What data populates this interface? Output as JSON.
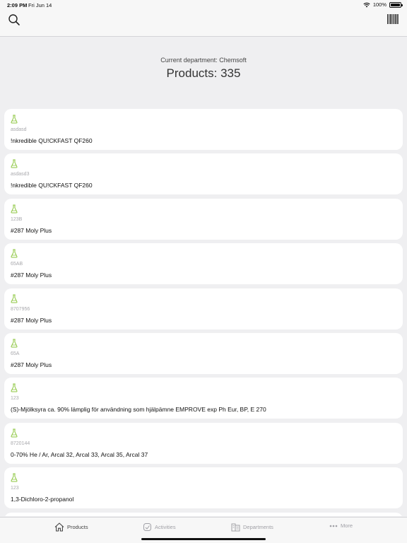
{
  "status_bar": {
    "time": "2:09 PM",
    "date": "Fri Jun 14",
    "battery": "100%",
    "battery_level": 1.0
  },
  "header": {
    "department": "Current department: Chemsoft",
    "products_count": "Products: 335"
  },
  "products": [
    {
      "code": "asdasd",
      "name": "!nkredible QU!CKFAST QF260"
    },
    {
      "code": "asdasd3",
      "name": "!nkredible QU!CKFAST QF260"
    },
    {
      "code": "123B",
      "name": "#287 Moly Plus"
    },
    {
      "code": "65AB",
      "name": "#287 Moly Plus"
    },
    {
      "code": "8707956",
      "name": "#287 Moly Plus"
    },
    {
      "code": "65A",
      "name": "#287 Moly Plus"
    },
    {
      "code": "123",
      "name": "(S)-Mjölksyra ca. 90% lämplig för användning som hjälpämne EMPROVE exp Ph Eur, BP, E 270"
    },
    {
      "code": "8720144",
      "name": "0-70% He / Ar, Arcal 32, Arcal 33, Arcal 35, Arcal 37"
    },
    {
      "code": "123",
      "name": "1,3-Dichloro-2-propanol"
    },
    {
      "code": "",
      "name": ""
    }
  ],
  "tabs": [
    {
      "label": "Products",
      "icon": "home-icon",
      "active": true
    },
    {
      "label": "Activities",
      "icon": "activities-icon",
      "active": false
    },
    {
      "label": "Departments",
      "icon": "departments-icon",
      "active": false
    },
    {
      "label": "More",
      "icon": "more-icon",
      "active": false
    }
  ],
  "colors": {
    "accent_green": "#8cc63f",
    "background": "#efeff1",
    "card": "#ffffff"
  }
}
